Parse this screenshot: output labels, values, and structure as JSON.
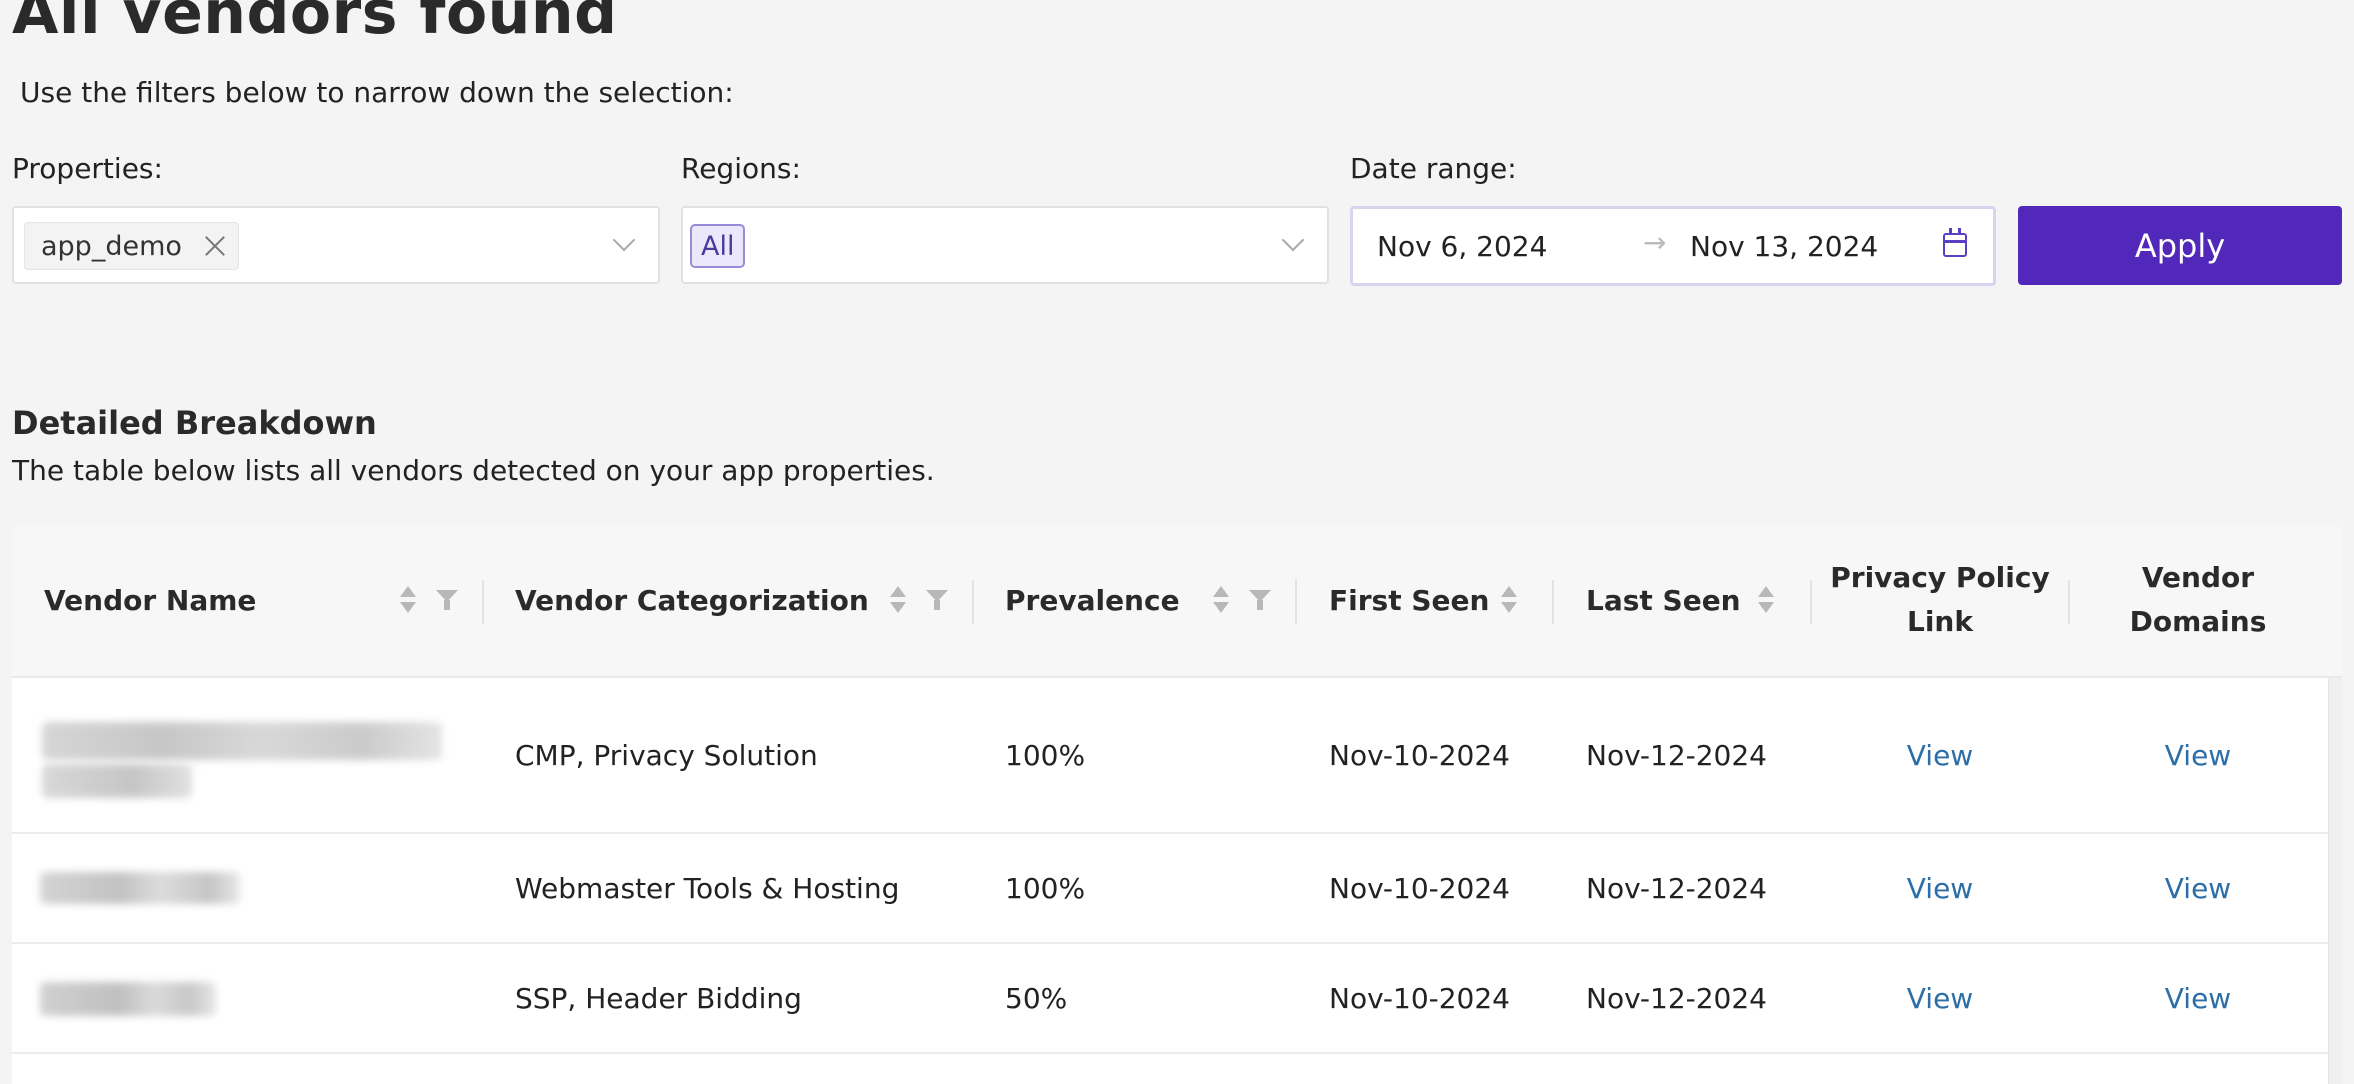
{
  "page": {
    "title": "All vendors found",
    "subtitle": "Use the filters below to narrow down the selection:"
  },
  "filters": {
    "properties": {
      "label": "Properties:",
      "selected_tag": "app_demo"
    },
    "regions": {
      "label": "Regions:",
      "selected_tag": "All"
    },
    "date_range": {
      "label": "Date range:",
      "start": "Nov 6, 2024",
      "arrow": "→",
      "end": "Nov 13, 2024"
    },
    "apply_label": "Apply"
  },
  "breakdown": {
    "title": "Detailed Breakdown",
    "description": "The table below lists all vendors detected on your app properties."
  },
  "table": {
    "columns": {
      "vendor_name": "Vendor Name",
      "vendor_categorization": "Vendor Categorization",
      "prevalence": "Prevalence",
      "first_seen": "First Seen",
      "last_seen": "Last Seen",
      "privacy_policy_link_line1": "Privacy Policy",
      "privacy_policy_link_line2": "Link",
      "vendor_domains_line1": "Vendor",
      "vendor_domains_line2": "Domains"
    },
    "rows": [
      {
        "categorization": "CMP, Privacy Solution",
        "prevalence": "100%",
        "first_seen": "Nov-10-2024",
        "last_seen": "Nov-12-2024",
        "privacy_link": "View",
        "domains_link": "View"
      },
      {
        "categorization": "Webmaster Tools & Hosting",
        "prevalence": "100%",
        "first_seen": "Nov-10-2024",
        "last_seen": "Nov-12-2024",
        "privacy_link": "View",
        "domains_link": "View"
      },
      {
        "categorization": "SSP, Header Bidding",
        "prevalence": "50%",
        "first_seen": "Nov-10-2024",
        "last_seen": "Nov-12-2024",
        "privacy_link": "View",
        "domains_link": "View"
      }
    ]
  },
  "colors": {
    "accent": "#5128b9",
    "link": "#2c6ea8",
    "background": "#f4f4f4"
  }
}
